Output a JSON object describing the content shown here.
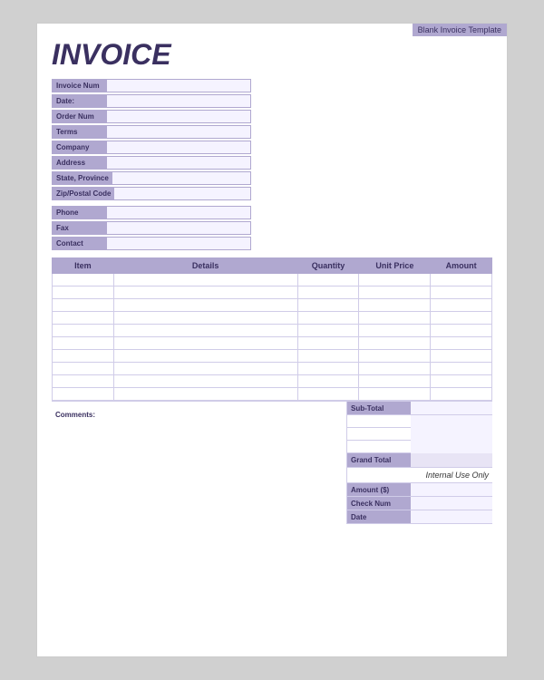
{
  "template": {
    "badge": "Blank Invoice Template"
  },
  "header": {
    "title": "INVOICE"
  },
  "invoice_info": {
    "fields": [
      {
        "label": "Invoice Num",
        "value": ""
      },
      {
        "label": "Date:",
        "value": ""
      },
      {
        "label": "Order Num",
        "value": ""
      },
      {
        "label": "Terms",
        "value": ""
      }
    ]
  },
  "address_info": {
    "fields": [
      {
        "label": "Company",
        "value": ""
      },
      {
        "label": "Address",
        "value": ""
      },
      {
        "label": "State, Province",
        "value": ""
      },
      {
        "label": "Zip/Postal Code",
        "value": ""
      }
    ]
  },
  "contact_info": {
    "fields": [
      {
        "label": "Phone",
        "value": ""
      },
      {
        "label": "Fax",
        "value": ""
      },
      {
        "label": "Contact",
        "value": ""
      }
    ]
  },
  "table": {
    "headers": [
      "Item",
      "Details",
      "Quantity",
      "Unit Price",
      "Amount"
    ],
    "rows": [
      [
        "",
        "",
        "",
        "",
        ""
      ],
      [
        "",
        "",
        "",
        "",
        ""
      ],
      [
        "",
        "",
        "",
        "",
        ""
      ],
      [
        "",
        "",
        "",
        "",
        ""
      ],
      [
        "",
        "",
        "",
        "",
        ""
      ],
      [
        "",
        "",
        "",
        "",
        ""
      ],
      [
        "",
        "",
        "",
        "",
        ""
      ],
      [
        "",
        "",
        "",
        "",
        ""
      ],
      [
        "",
        "",
        "",
        "",
        ""
      ],
      [
        "",
        "",
        "",
        "",
        ""
      ]
    ]
  },
  "bottom": {
    "comments_label": "Comments:",
    "subtotal_label": "Sub-Total",
    "subtotal_value": "",
    "empty_rows": [
      "",
      "",
      ""
    ],
    "grand_total_label": "Grand Total",
    "grand_total_value": "",
    "internal_use_label": "Internal Use Only",
    "payment_fields": [
      {
        "label": "Amount ($)",
        "value": ""
      },
      {
        "label": "Check Num",
        "value": ""
      },
      {
        "label": "Date",
        "value": ""
      }
    ]
  },
  "colors": {
    "purple_bg": "#b0a8d0",
    "purple_text": "#3a3060",
    "light_purple": "#f5f3ff"
  }
}
